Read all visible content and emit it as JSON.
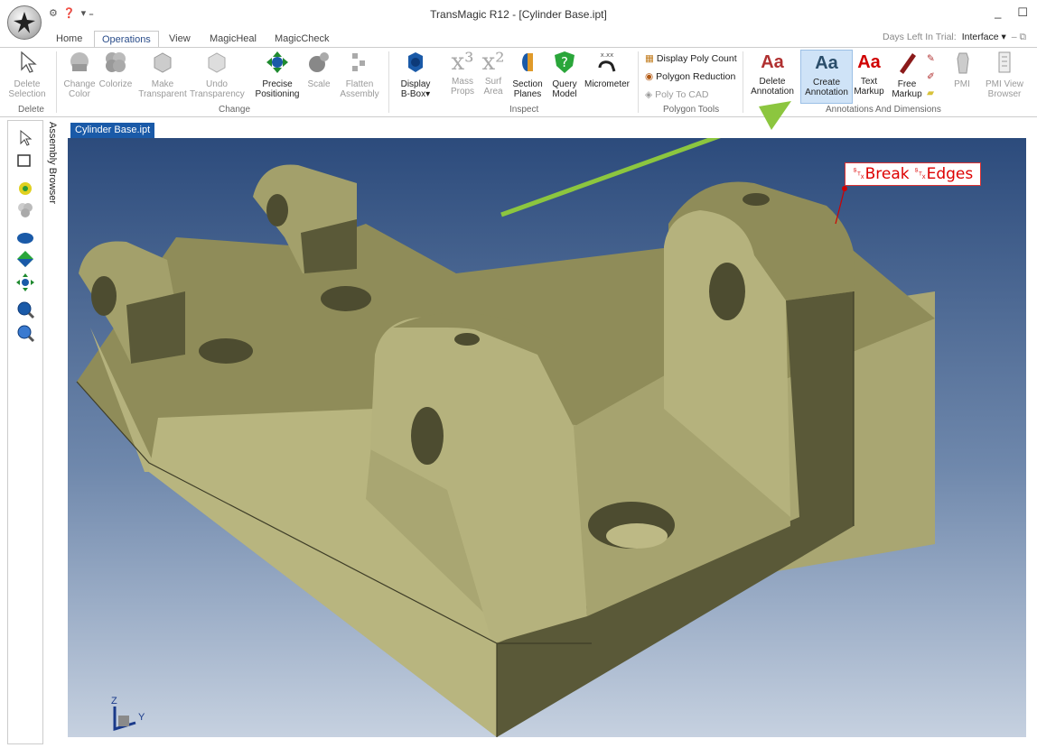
{
  "window": {
    "title": "TransMagic R12 - [Cylinder Base.ipt]",
    "minimize": "_",
    "maximize": "☐"
  },
  "tabs": [
    {
      "label": "Home"
    },
    {
      "label": "Operations",
      "active": true
    },
    {
      "label": "View"
    },
    {
      "label": "MagicHeal"
    },
    {
      "label": "MagicCheck"
    }
  ],
  "trial": {
    "text": "Days Left In Trial:",
    "interface": "Interface ▾"
  },
  "ribbon": {
    "delete_group": {
      "label": "Delete",
      "delete_selection": "Delete\nSelection"
    },
    "change_group": {
      "label": "Change",
      "change_color": "Change\nColor",
      "colorize": "Colorize",
      "make_transparent": "Make\nTransparent",
      "undo_transparency": "Undo\nTransparency",
      "precise_positioning": "Precise\nPositioning",
      "scale": "Scale",
      "flatten_assembly": "Flatten\nAssembly"
    },
    "inspect_group": {
      "label": "Inspect",
      "display_bbox": "Display\nB-Box▾",
      "mass_props": "Mass\nProps",
      "surf_area": "Surf\nArea",
      "section_planes": "Section\nPlanes",
      "query_model": "Query\nModel",
      "micrometer": "Micrometer"
    },
    "polygon_group": {
      "label": "Polygon Tools",
      "display_poly_count": "Display Poly Count",
      "polygon_reduction": "Polygon Reduction",
      "poly_to_cad": "Poly To CAD"
    },
    "annotations_group": {
      "label": "Annotations And Dimensions",
      "delete_annotation": "Delete\nAnnotation",
      "create_annotation": "Create\nAnnotation",
      "text_markup": "Text\nMarkup",
      "free_markup": "Free\nMarkup",
      "pmi": "PMI",
      "pmi_view_browser": "PMI View\nBrowser"
    }
  },
  "assembly_browser": "Assembly Browser",
  "document_tab": "Cylinder Base.ipt",
  "annotation": {
    "text": "␂Break ␂Edges"
  },
  "axes": {
    "z": "Z",
    "y": "Y"
  },
  "colors": {
    "accent": "#2a4d8a",
    "part_light": "#b5b27d",
    "part_mid": "#8f8c59",
    "part_dark": "#5a5938",
    "arrow": "#8cc63f",
    "annot": "#dd0000"
  }
}
